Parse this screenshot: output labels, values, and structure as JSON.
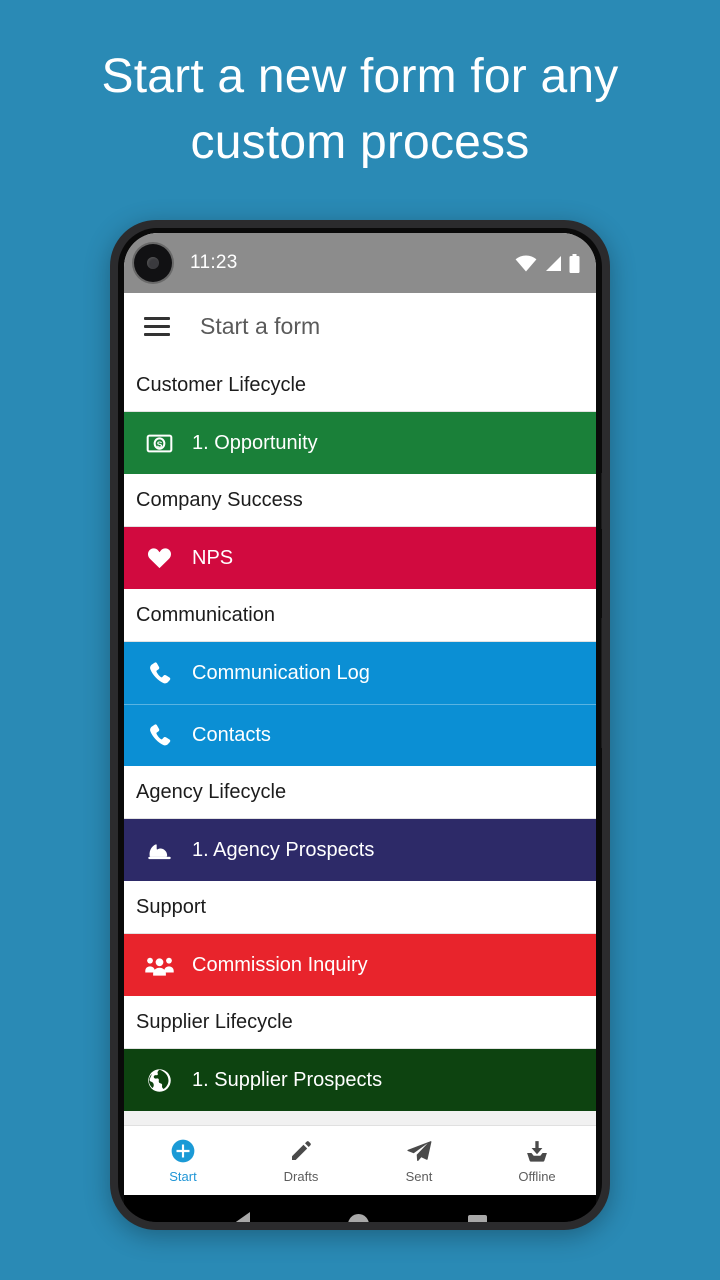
{
  "headline": "Start a new form for any custom process",
  "background_color": "#2a8ab5",
  "status_bar": {
    "time": "11:23",
    "icons": [
      "wifi-icon",
      "signal-icon",
      "battery-icon"
    ]
  },
  "app_bar": {
    "menu_icon": "hamburger-menu-icon",
    "title": "Start a form"
  },
  "list": [
    {
      "type": "header",
      "label": "Customer Lifecycle"
    },
    {
      "type": "form",
      "label": "1. Opportunity",
      "icon": "money-banknote-icon",
      "color": "#1a8039"
    },
    {
      "type": "header",
      "label": "Company Success"
    },
    {
      "type": "form",
      "label": "NPS",
      "icon": "heart-icon",
      "color": "#d10a3f"
    },
    {
      "type": "header",
      "label": "Communication"
    },
    {
      "type": "form",
      "label": "Communication Log",
      "icon": "phone-icon",
      "color": "#0b8fd4"
    },
    {
      "type": "form",
      "label": "Contacts",
      "icon": "phone-icon",
      "color": "#0b8fd4"
    },
    {
      "type": "header",
      "label": "Agency Lifecycle"
    },
    {
      "type": "form",
      "label": "1. Agency Prospects",
      "icon": "hard-hat-icon",
      "color": "#2d2a68"
    },
    {
      "type": "header",
      "label": "Support"
    },
    {
      "type": "form",
      "label": "Commission Inquiry",
      "icon": "people-group-icon",
      "color": "#e8242c"
    },
    {
      "type": "header",
      "label": "Supplier Lifecycle"
    },
    {
      "type": "form",
      "label": "1. Supplier Prospects",
      "icon": "globe-icon",
      "color": "#0d4310"
    }
  ],
  "bottom_nav": {
    "accent_color": "#2196d6",
    "items": [
      {
        "label": "Start",
        "icon": "plus-circle-icon",
        "active": true
      },
      {
        "label": "Drafts",
        "icon": "pencil-icon",
        "active": false
      },
      {
        "label": "Sent",
        "icon": "paper-plane-icon",
        "active": false
      },
      {
        "label": "Offline",
        "icon": "download-tray-icon",
        "active": false
      }
    ]
  },
  "android_nav": {
    "back": "back-triangle-icon",
    "home": "home-circle-icon",
    "recents": "recents-square-icon"
  }
}
